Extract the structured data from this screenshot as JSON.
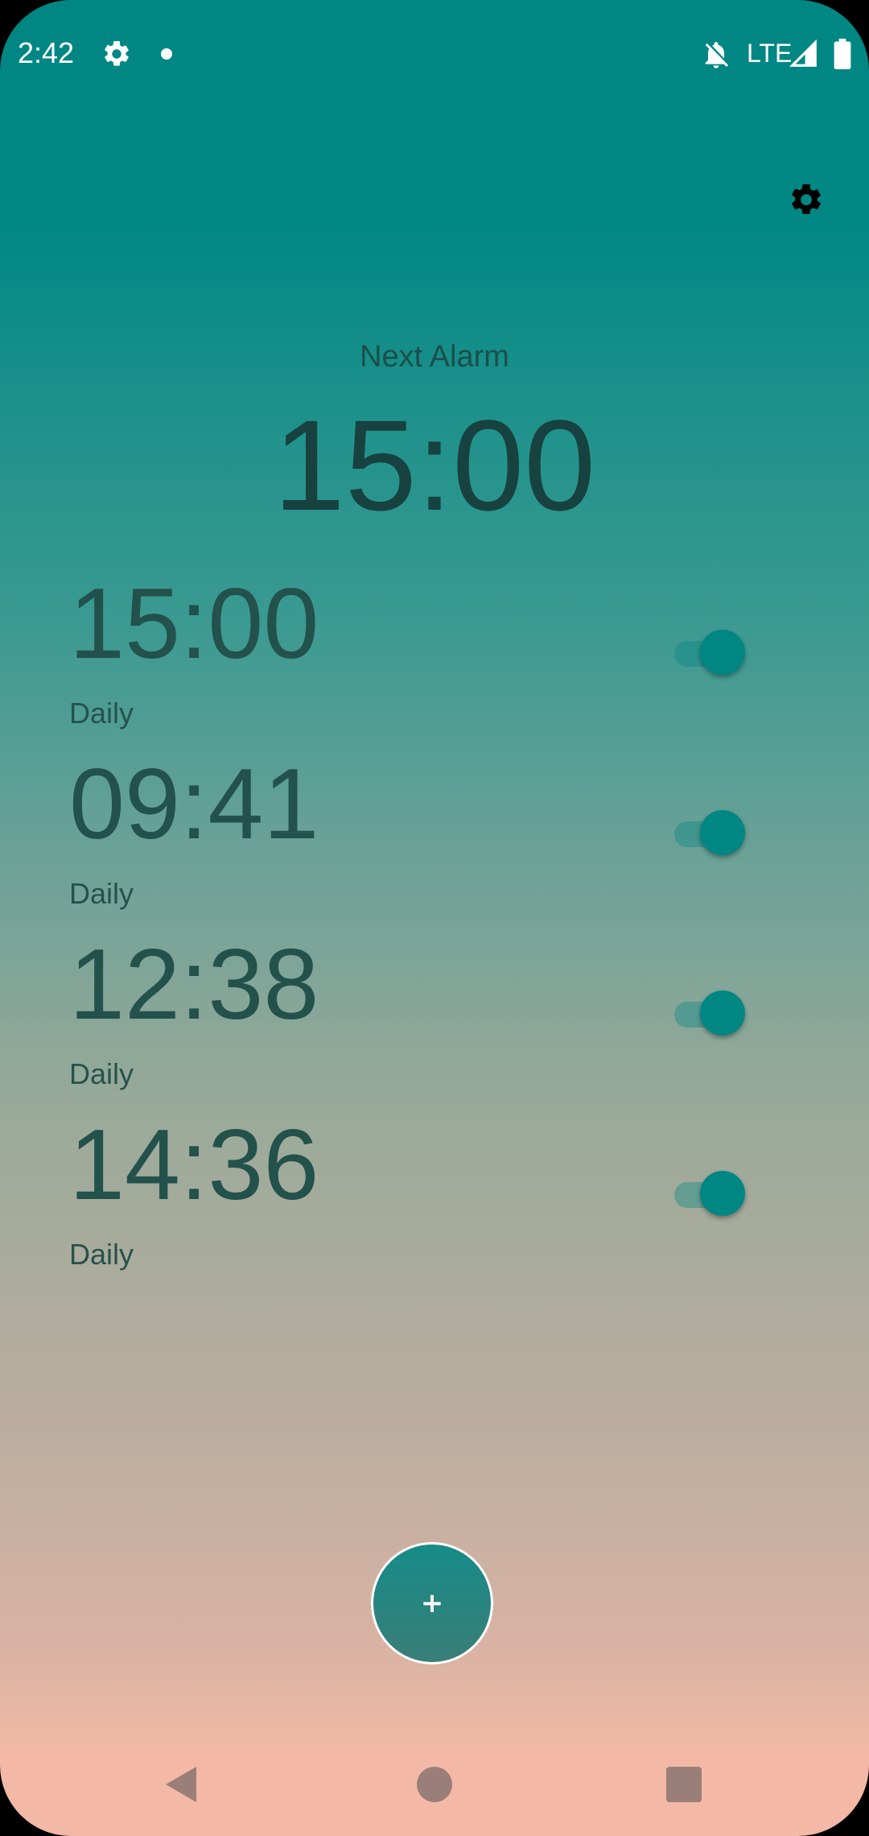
{
  "status_bar": {
    "time": "2:42",
    "network": "LTE",
    "icons": [
      "settings-icon",
      "notification-dot-icon",
      "bell-off-icon",
      "signal-icon",
      "battery-icon"
    ]
  },
  "header": {
    "settings_icon": "gear-icon"
  },
  "next_alarm": {
    "label": "Next Alarm",
    "time": "15:00"
  },
  "alarms": [
    {
      "time": "15:00",
      "repeat": "Daily",
      "enabled": true
    },
    {
      "time": "09:41",
      "repeat": "Daily",
      "enabled": true
    },
    {
      "time": "12:38",
      "repeat": "Daily",
      "enabled": true
    },
    {
      "time": "14:36",
      "repeat": "Daily",
      "enabled": true
    }
  ],
  "fab": {
    "label": "+"
  },
  "colors": {
    "accent": "#008784",
    "gradient_top": "#008784",
    "gradient_bottom": "#F4B8A6",
    "text_dark": "#17423F"
  },
  "navigation": {
    "icons": [
      "back-icon",
      "home-icon",
      "recents-icon"
    ]
  }
}
